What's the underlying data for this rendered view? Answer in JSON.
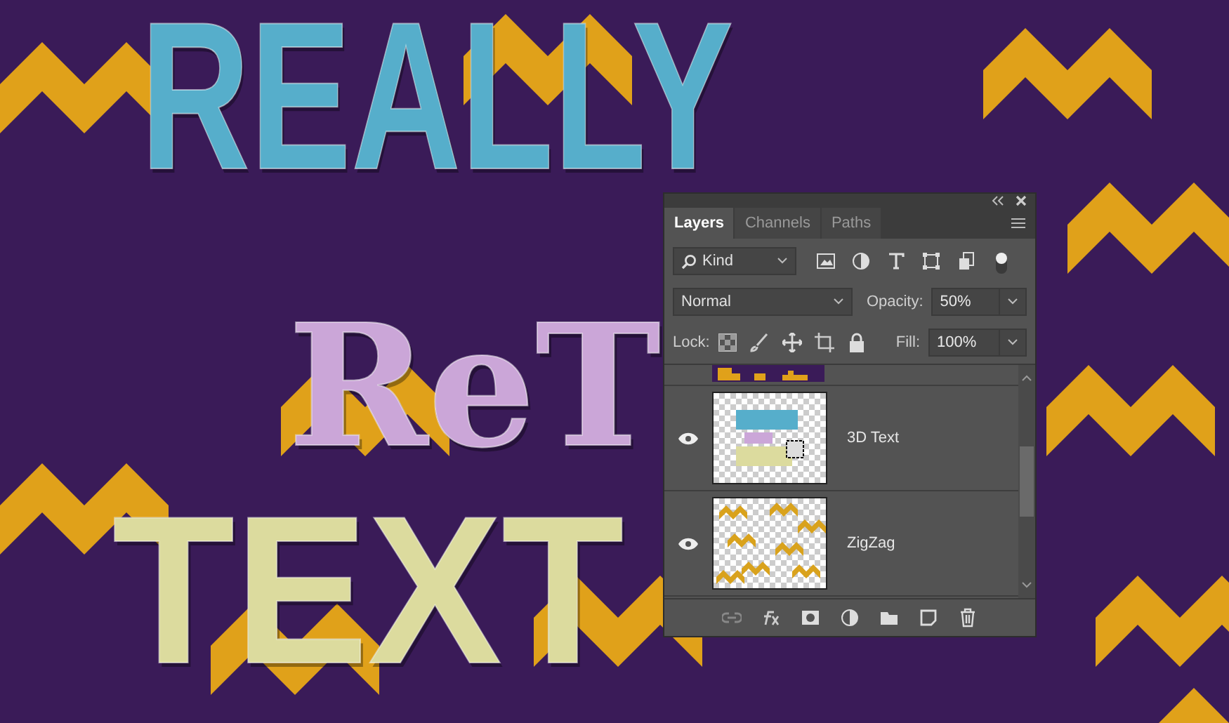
{
  "canvas": {
    "words": [
      {
        "text": "REALLY",
        "color": "#56aecb"
      },
      {
        "text": "ReT",
        "color": "#cba6d8"
      },
      {
        "text": "TEXT",
        "color": "#dcdb9e"
      }
    ]
  },
  "layers_panel": {
    "tabs": [
      {
        "label": "Layers",
        "selected": true
      },
      {
        "label": "Channels",
        "selected": false
      },
      {
        "label": "Paths",
        "selected": false
      }
    ],
    "filter": {
      "value": "Kind"
    },
    "blend_mode": {
      "value": "Normal"
    },
    "opacity": {
      "label": "Opacity:",
      "value": "50%"
    },
    "lock": {
      "label": "Lock:"
    },
    "fill": {
      "label": "Fill:",
      "value": "100%"
    },
    "layers": [
      {
        "name": "3D Text",
        "visible": true,
        "kind": "text"
      },
      {
        "name": "ZigZag",
        "visible": true,
        "kind": "zigzag"
      }
    ]
  }
}
